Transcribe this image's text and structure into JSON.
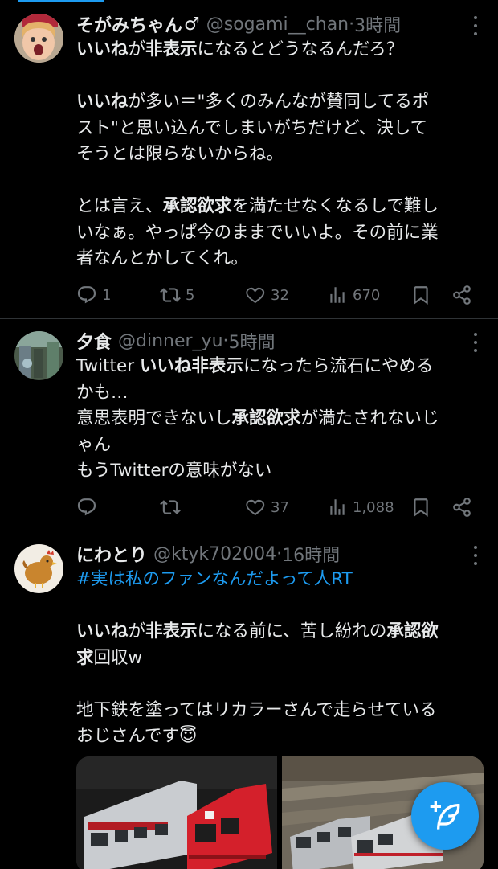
{
  "tweets": [
    {
      "name": "そがみちゃん",
      "name_emoji": "♂",
      "handle": "@sogami__chan",
      "sep": " · ",
      "time": "3時間",
      "lines": [
        [
          {
            "t": "いいね",
            "b": true
          },
          {
            "t": "が"
          },
          {
            "t": "非表示",
            "b": true
          },
          {
            "t": "になるとどうなるんだろ？"
          }
        ],
        [],
        [
          {
            "t": "いいね",
            "b": true
          },
          {
            "t": "が多い＝\"多くのみんなが賛同してるポ"
          }
        ],
        [
          {
            "t": "スト\"と思い込んでしまいがちだけど、決して"
          }
        ],
        [
          {
            "t": "そうとは限らないからね。"
          }
        ],
        [],
        [
          {
            "t": "とは言え、"
          },
          {
            "t": "承認欲求",
            "b": true
          },
          {
            "t": "を満たせなくなるしで難し"
          }
        ],
        [
          {
            "t": "いなぁ。やっぱ今のままでいいよ。その前に業"
          }
        ],
        [
          {
            "t": "者なんとかしてくれ。"
          }
        ]
      ],
      "replies": "1",
      "retweets": "5",
      "likes": "32",
      "views": "670"
    },
    {
      "name": "夕食",
      "handle": "@dinner_yu",
      "sep": " · ",
      "time": "5時間",
      "lines": [
        [
          {
            "t": "Twitter "
          },
          {
            "t": "いいね",
            "b": true
          },
          {
            "t": "非表示",
            "b": true
          },
          {
            "t": "になったら流石にやめる"
          }
        ],
        [
          {
            "t": "かも…"
          }
        ],
        [
          {
            "t": "意思表明できないし"
          },
          {
            "t": "承認欲求",
            "b": true
          },
          {
            "t": "が満たされないじ"
          }
        ],
        [
          {
            "t": "ゃん"
          }
        ],
        [
          {
            "t": "もうTwitterの意味がない"
          }
        ]
      ],
      "replies": "",
      "retweets": "",
      "likes": "37",
      "views": "1,088"
    },
    {
      "name": "にわとり",
      "handle": "@ktyk702004",
      "sep": " · ",
      "time": "16時間",
      "hashtag": "#実は私のファンなんだよって人RT",
      "lines": [
        [],
        [
          {
            "t": "いいね",
            "b": true
          },
          {
            "t": "が"
          },
          {
            "t": "非表示",
            "b": true
          },
          {
            "t": "になる前に、苦し紛れの"
          },
          {
            "t": "承認欲",
            "b": true
          }
        ],
        [
          {
            "t": "求",
            "b": true
          },
          {
            "t": "回収w"
          }
        ],
        [],
        [
          {
            "t": "地下鉄を塗ってはリカラーさんで走らせている"
          }
        ],
        [
          {
            "t": "おじさんです"
          },
          {
            "t": "😇"
          }
        ]
      ]
    }
  ],
  "icons": {
    "reply": "reply-icon",
    "retweet": "retweet-icon",
    "like": "heart-icon",
    "views": "views-icon",
    "bookmark": "bookmark-icon",
    "share": "share-icon",
    "compose": "compose-icon"
  },
  "colors": {
    "accent": "#1d9bf0",
    "text": "#e7e9ea",
    "muted": "#71767b",
    "divider": "#2f3336"
  }
}
